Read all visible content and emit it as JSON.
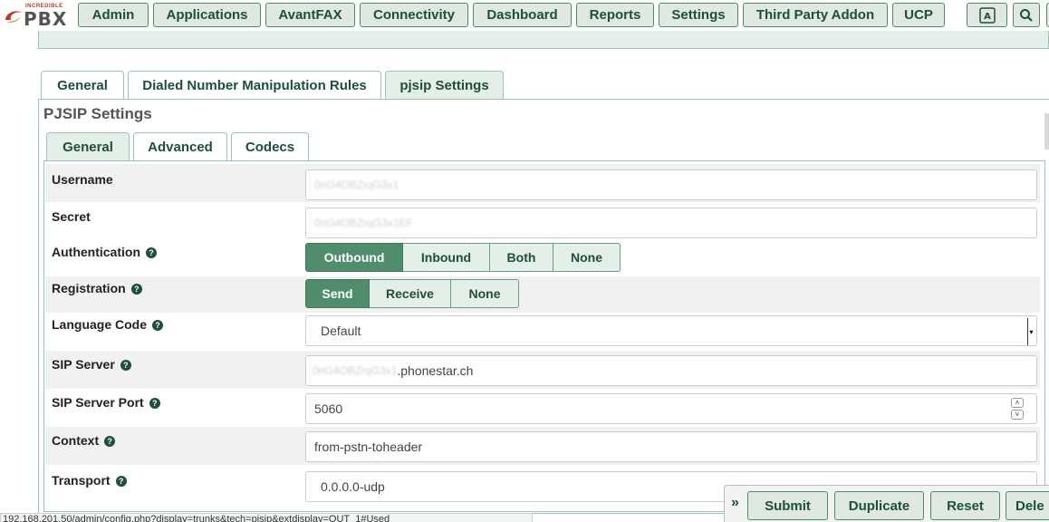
{
  "logo": {
    "small": "INCREDIBLE",
    "big": "PBX"
  },
  "nav": [
    "Admin",
    "Applications",
    "AvantFAX",
    "Connectivity",
    "Dashboard",
    "Reports",
    "Settings",
    "Third Party Addon",
    "UCP"
  ],
  "outer_tabs": [
    "General",
    "Dialed Number Manipulation Rules",
    "pjsip Settings"
  ],
  "section_title": "PJSIP Settings",
  "inner_tabs": [
    "General",
    "Advanced",
    "Codecs"
  ],
  "form": {
    "username": {
      "label": "Username",
      "value": "0nG4OBZrqG3x1"
    },
    "secret": {
      "label": "Secret",
      "value": "0nG4OBZrqG3x1EF"
    },
    "authentication": {
      "label": "Authentication",
      "options": [
        "Outbound",
        "Inbound",
        "Both",
        "None"
      ],
      "selected": "Outbound"
    },
    "registration": {
      "label": "Registration",
      "options": [
        "Send",
        "Receive",
        "None"
      ],
      "selected": "Send"
    },
    "language_code": {
      "label": "Language Code",
      "value": "Default"
    },
    "sip_server": {
      "label": "SIP Server",
      "hidden_part": "0nG4OBZrqG3x1",
      "value": ".phonestar.ch"
    },
    "sip_server_port": {
      "label": "SIP Server Port",
      "value": "5060"
    },
    "context": {
      "label": "Context",
      "value": "from-pstn-toheader"
    },
    "transport": {
      "label": "Transport",
      "value": "0.0.0.0-udp"
    }
  },
  "actions": {
    "submit": "Submit",
    "duplicate": "Duplicate",
    "reset": "Reset",
    "delete": "Dele"
  },
  "status_url": "192.168.201.50/admin/config.php?display=trunks&tech=pjsip&extdisplay=OUT_1#Used",
  "colors": {
    "primary": "#4f8d6c",
    "tab_bg": "#e3efe8",
    "border": "#9fc3b0",
    "text": "#1f4e3c"
  }
}
